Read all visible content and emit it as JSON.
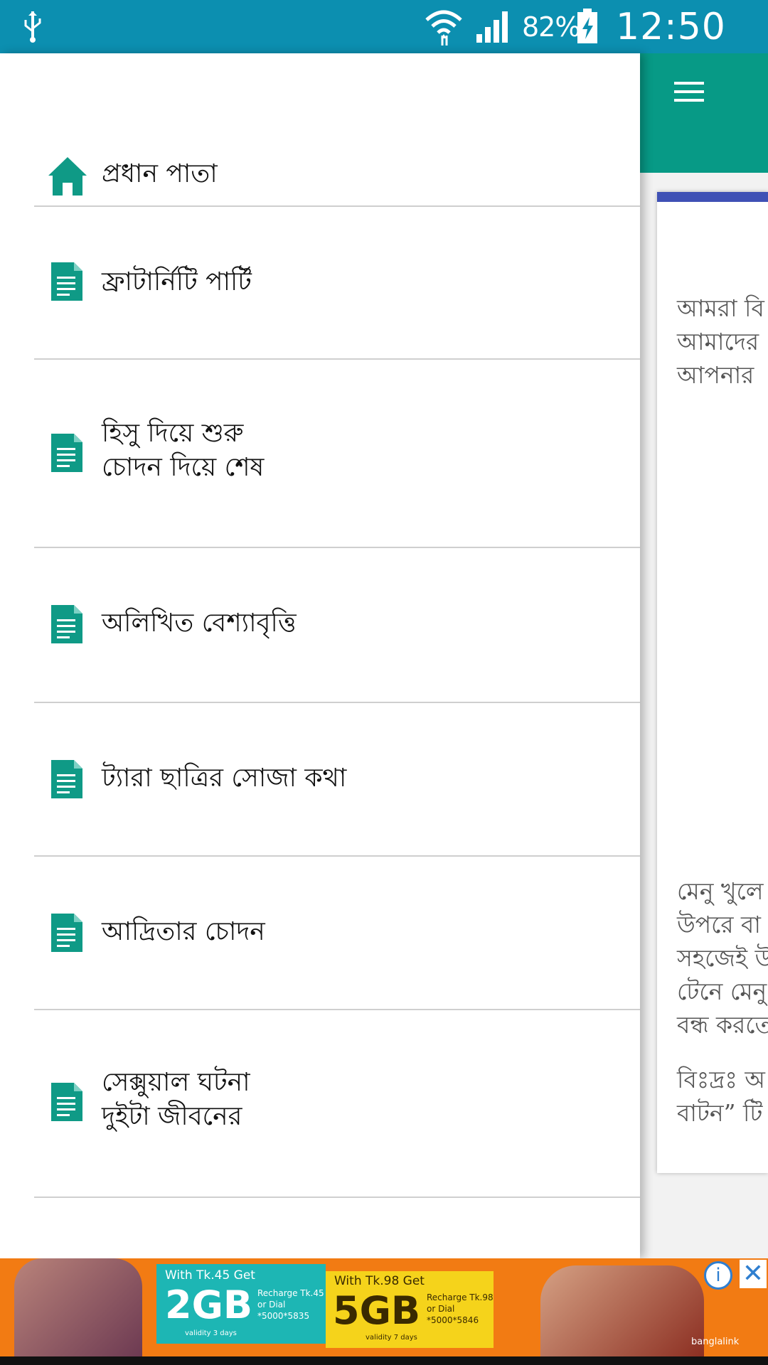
{
  "status_bar": {
    "battery_percent": "82%",
    "time": "12:50 PM",
    "icons": [
      "usb-icon",
      "wifi-icon",
      "cell-signal-icon",
      "battery-charging-icon"
    ]
  },
  "drawer": {
    "items": [
      {
        "icon": "home-icon",
        "line1": "প্রধান পাতা",
        "line2": ""
      },
      {
        "icon": "document-icon",
        "line1": "ফ্রাটার্নিটি পার্টি",
        "line2": ""
      },
      {
        "icon": "document-icon",
        "line1": "হিসু দিয়ে শুরু",
        "line2": "চোদন দিয়ে শেষ"
      },
      {
        "icon": "document-icon",
        "line1": "অলিখিত বেশ্যাবৃত্তি",
        "line2": ""
      },
      {
        "icon": "document-icon",
        "line1": "ট্যারা ছাত্রির সোজা কথা",
        "line2": ""
      },
      {
        "icon": "document-icon",
        "line1": "আদ্রিতার চোদন",
        "line2": ""
      },
      {
        "icon": "document-icon",
        "line1": "সেক্সুয়াল ঘটনা",
        "line2": "দুইটা জীবনের"
      }
    ]
  },
  "background_page": {
    "toolbar_icon": "menu-icon",
    "accent_color": "#3f51b5",
    "text_block_1": [
      "আমরা  বি",
      "আমাদের",
      "আপনার"
    ],
    "text_block_2": [
      "মেনু খুলে",
      "উপরে বা",
      "সহজেই উ",
      "টেনে মেনু",
      "বন্ধ করতে"
    ],
    "text_block_3": [
      "বিঃদ্রঃ অ",
      "বাটন” টি"
    ]
  },
  "ad": {
    "offer1_head": "With Tk.45 Get",
    "offer1_big": "2GB",
    "offer1_sub": "Recharge Tk.45",
    "offer1_dial": "or Dial",
    "offer1_code": "*5000*5835",
    "offer1_validity": "validity 3 days",
    "offer2_head": "With Tk.98 Get",
    "offer2_big": "5GB",
    "offer2_sub": "Recharge Tk.98",
    "offer2_dial": "or Dial",
    "offer2_code": "*5000*5846",
    "offer2_validity": "validity 7 days",
    "brand": "banglalink",
    "info_glyph": "i",
    "close_glyph": "✕"
  },
  "colors": {
    "status_bar": "#0c8fb0",
    "toolbar": "#079a86",
    "icon_teal": "#0f9a86"
  }
}
